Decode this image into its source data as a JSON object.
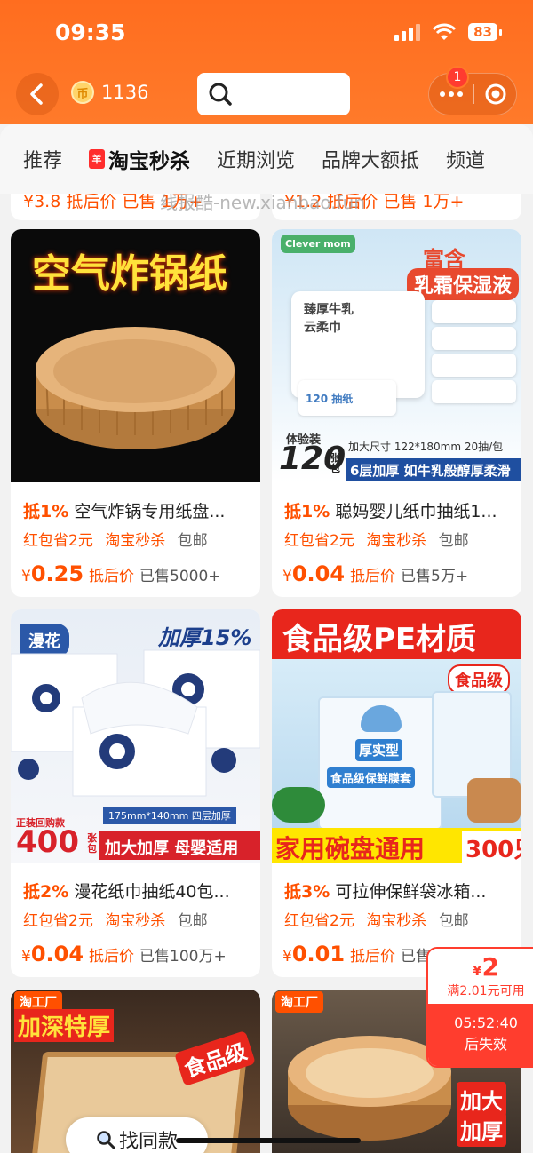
{
  "status_bar": {
    "time": "09:35",
    "battery": "83"
  },
  "header": {
    "coin_symbol": "币",
    "coin_count": "1136",
    "notification_badge": "1"
  },
  "tabs": [
    {
      "label": "推荐"
    },
    {
      "label": "淘宝秒杀",
      "tag": "羊"
    },
    {
      "label": "近期浏览"
    },
    {
      "label": "品牌大额抵"
    },
    {
      "label": "频道"
    }
  ],
  "partial_row": {
    "left_text": "¥3.8 抵后价 已售 1万+",
    "right_text": "¥1.2 抵后价 已售 1万+"
  },
  "watermark": "线报酷-new.xianbao.fun",
  "products": [
    {
      "discount": "抵1%",
      "title": "空气炸锅专用纸盘...",
      "tags": [
        "红包省2元",
        "淘宝秒杀",
        "包邮"
      ],
      "yen": "¥",
      "price": "0.25",
      "price_label": "抵后价",
      "sold": "已售5000+",
      "image_text": [
        "空气炸锅纸"
      ]
    },
    {
      "discount": "抵1%",
      "title": "聪妈婴儿纸巾抽纸1...",
      "tags": [
        "红包省2元",
        "淘宝秒杀",
        "包邮"
      ],
      "yen": "¥",
      "price": "0.04",
      "price_label": "抵后价",
      "sold": "已售5万+",
      "image_text": [
        "富含",
        "乳霜保湿液",
        "体验装",
        "120",
        "张包",
        "加大尺寸 122*180mm 20抽/包",
        "6层加厚 如牛乳般醇厚柔滑",
        "臻厚牛乳",
        "云柔巾",
        "120 抽纸"
      ]
    },
    {
      "discount": "抵2%",
      "title": "漫花纸巾抽纸40包...",
      "tags": [
        "红包省2元",
        "淘宝秒杀",
        "包邮"
      ],
      "yen": "¥",
      "price": "0.04",
      "price_label": "抵后价",
      "sold": "已售100万+",
      "image_text": [
        "漫花",
        "加厚15%",
        "175mm*140mm 四层加厚",
        "正装回购款",
        "400",
        "张包",
        "加大加厚 母婴适用"
      ]
    },
    {
      "discount": "抵3%",
      "title": "可拉伸保鲜袋冰箱...",
      "tags": [
        "红包省2元",
        "淘宝秒杀",
        "包邮"
      ],
      "yen": "¥",
      "price": "0.01",
      "price_label": "抵后价",
      "sold": "已售",
      "image_text": [
        "食品级PE材质",
        "食品级",
        "厚实型",
        "食品级保鲜膜套",
        "家用碗盘通用",
        "300只"
      ]
    },
    {
      "image_text": [
        "淘工厂",
        "加深特厚",
        "食品级"
      ]
    },
    {
      "image_text": [
        "淘工厂",
        "加大",
        "加厚"
      ]
    }
  ],
  "coupon": {
    "amount_symbol": "¥",
    "amount": "2",
    "condition": "满2.01元可用",
    "countdown": "05:52:40",
    "expire_label": "后失效"
  },
  "find_similar": "找同款",
  "colors": {
    "brand_orange": "#ff6d1f",
    "price_orange": "#ff5000",
    "coupon_red": "#ff3d2e"
  }
}
